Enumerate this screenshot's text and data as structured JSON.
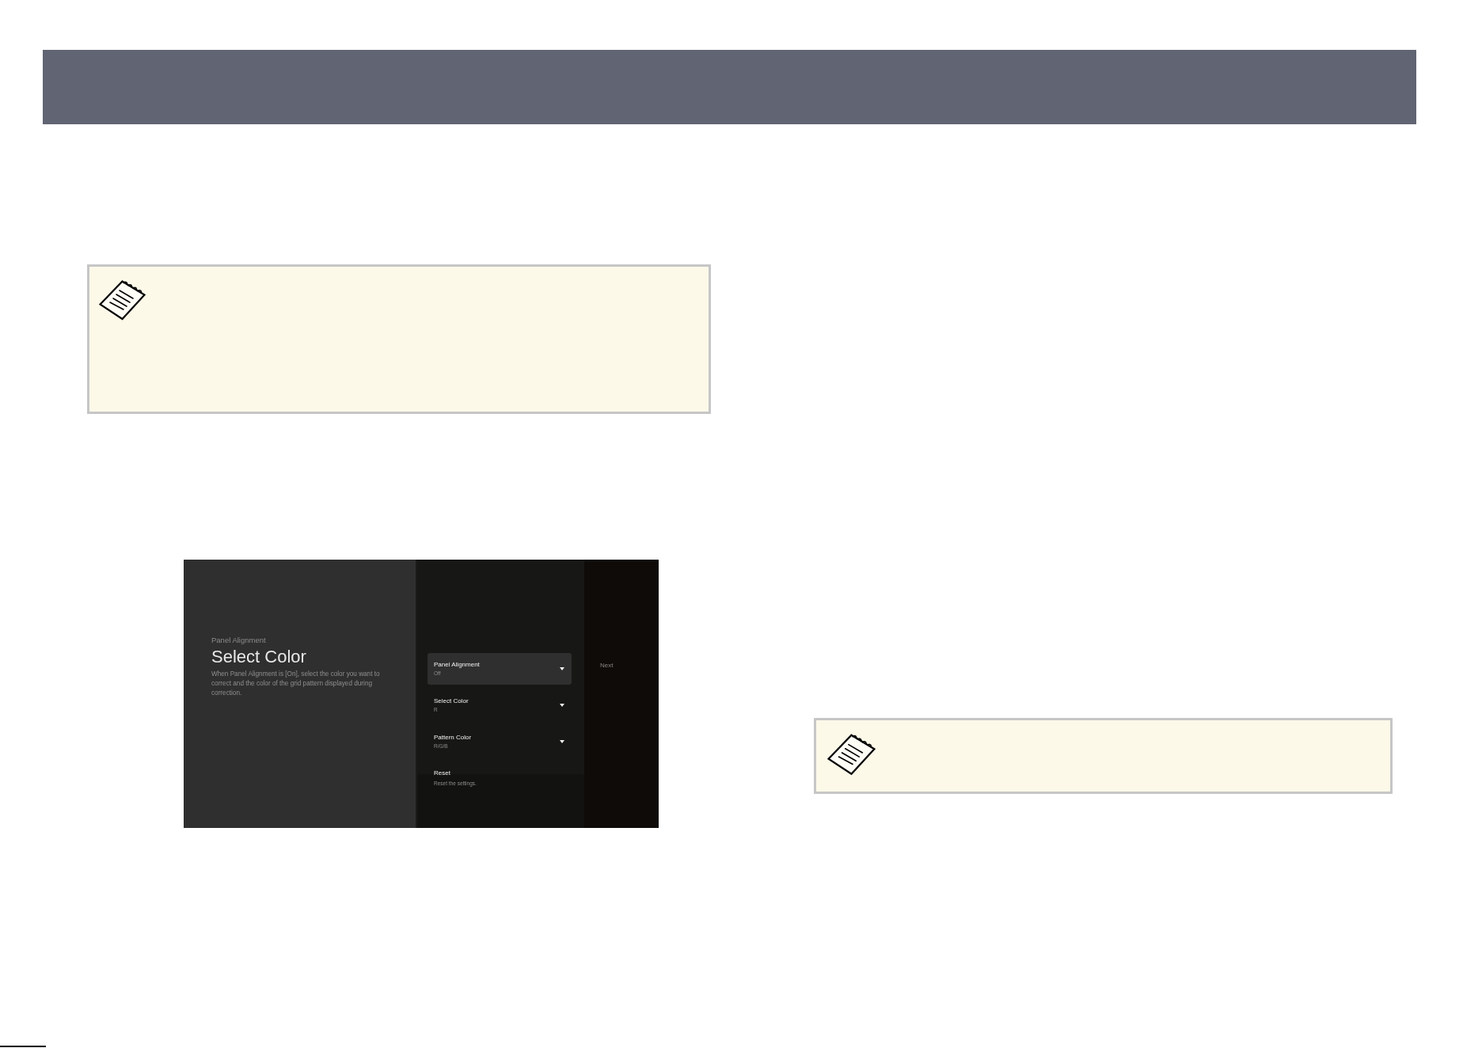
{
  "screenshot": {
    "info_panel": {
      "breadcrumb": "Panel Alignment",
      "title": "Select Color",
      "description": "When Panel Alignment is [On], select the color you want to correct and the color of the grid pattern displayed during correction."
    },
    "menu_items": [
      {
        "kind": "dropdown",
        "label": "Panel Alignment",
        "value": "Off",
        "selected": true
      },
      {
        "kind": "dropdown",
        "label": "Select Color",
        "value": "R",
        "selected": false
      },
      {
        "kind": "dropdown",
        "label": "Pattern Color",
        "value": "R/G/B",
        "selected": false
      },
      {
        "kind": "action",
        "label": "Reset",
        "value": "Reset the settings.",
        "selected": false
      }
    ],
    "side_button": "Next"
  }
}
